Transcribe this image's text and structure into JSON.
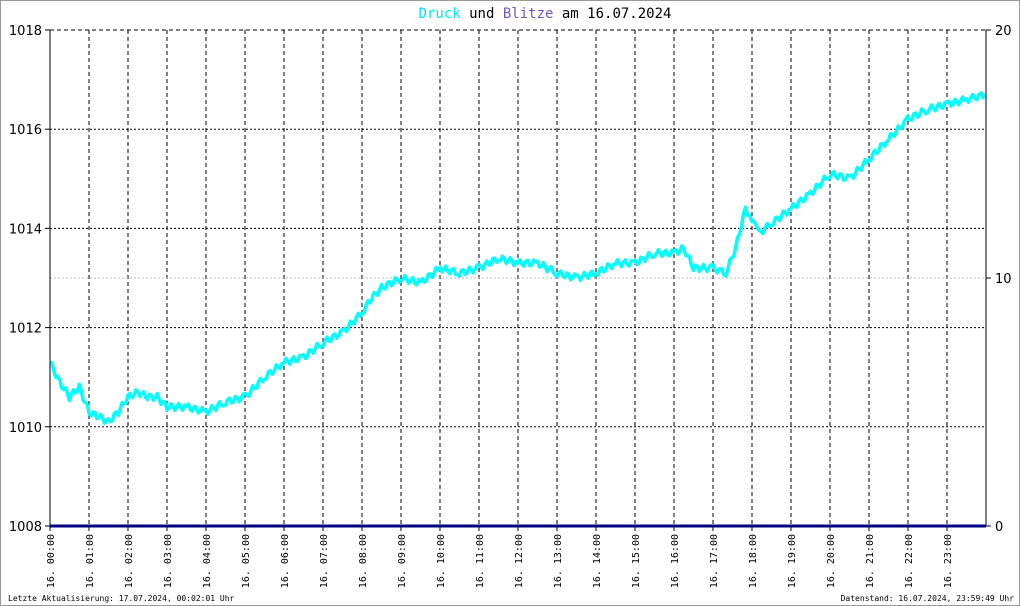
{
  "chart_data": {
    "type": "line",
    "title": {
      "part1": "Druck",
      "part2": " und ",
      "part3": "Blitze",
      "part4": " am 16.07.2024"
    },
    "colors": {
      "druck": "#00ffff",
      "blitze": "#6a5acd",
      "grid": "#000000",
      "axis": "#000080"
    },
    "y_left": {
      "range": [
        1008,
        1018
      ],
      "ticks": [
        "1008",
        "1010",
        "1012",
        "1014",
        "1016",
        "1018"
      ]
    },
    "y_right": {
      "range": [
        0,
        20
      ],
      "ticks": [
        "0",
        "10",
        "20"
      ]
    },
    "x": {
      "range_hours": [
        0,
        24
      ],
      "ticks": [
        "16. 00:00",
        "16. 01:00",
        "16. 02:00",
        "16. 03:00",
        "16. 04:00",
        "16. 05:00",
        "16. 06:00",
        "16. 07:00",
        "16. 08:00",
        "16. 09:00",
        "16. 10:00",
        "16. 11:00",
        "16. 12:00",
        "16. 13:00",
        "16. 14:00",
        "16. 15:00",
        "16. 16:00",
        "16. 17:00",
        "16. 18:00",
        "16. 19:00",
        "16. 20:00",
        "16. 21:00",
        "16. 22:00",
        "16. 23:00"
      ]
    },
    "series": [
      {
        "name": "Druck",
        "points": [
          [
            0,
            1011.3
          ],
          [
            0.25,
            1010.9
          ],
          [
            0.5,
            1010.6
          ],
          [
            0.75,
            1010.8
          ],
          [
            1,
            1010.3
          ],
          [
            1.25,
            1010.2
          ],
          [
            1.5,
            1010.1
          ],
          [
            1.75,
            1010.3
          ],
          [
            2,
            1010.6
          ],
          [
            2.25,
            1010.7
          ],
          [
            2.5,
            1010.6
          ],
          [
            2.75,
            1010.6
          ],
          [
            3,
            1010.4
          ],
          [
            3.5,
            1010.4
          ],
          [
            4,
            1010.3
          ],
          [
            4.5,
            1010.5
          ],
          [
            5,
            1010.6
          ],
          [
            5.5,
            1011.0
          ],
          [
            6,
            1011.3
          ],
          [
            6.5,
            1011.4
          ],
          [
            7,
            1011.7
          ],
          [
            7.5,
            1011.9
          ],
          [
            8,
            1012.3
          ],
          [
            8.25,
            1012.6
          ],
          [
            8.5,
            1012.8
          ],
          [
            9,
            1013.0
          ],
          [
            9.5,
            1012.9
          ],
          [
            10,
            1013.2
          ],
          [
            10.5,
            1013.1
          ],
          [
            11,
            1013.2
          ],
          [
            11.5,
            1013.4
          ],
          [
            12,
            1013.3
          ],
          [
            12.5,
            1013.3
          ],
          [
            13,
            1013.1
          ],
          [
            13.5,
            1013.0
          ],
          [
            14,
            1013.1
          ],
          [
            14.5,
            1013.3
          ],
          [
            15,
            1013.3
          ],
          [
            15.5,
            1013.5
          ],
          [
            16,
            1013.5
          ],
          [
            16.25,
            1013.6
          ],
          [
            16.5,
            1013.2
          ],
          [
            17,
            1013.2
          ],
          [
            17.33,
            1013.1
          ],
          [
            17.58,
            1013.6
          ],
          [
            17.83,
            1014.4
          ],
          [
            18,
            1014.2
          ],
          [
            18.17,
            1013.9
          ],
          [
            18.5,
            1014.1
          ],
          [
            19,
            1014.4
          ],
          [
            19.5,
            1014.7
          ],
          [
            20,
            1015.1
          ],
          [
            20.5,
            1015.0
          ],
          [
            21,
            1015.4
          ],
          [
            21.5,
            1015.8
          ],
          [
            22,
            1016.2
          ],
          [
            22.5,
            1016.4
          ],
          [
            23,
            1016.5
          ],
          [
            23.5,
            1016.6
          ],
          [
            23.98,
            1016.7
          ]
        ]
      },
      {
        "name": "Blitze",
        "points": []
      }
    ]
  },
  "footer": {
    "left": "Letzte Aktualisierung: 17.07.2024, 00:02:01 Uhr",
    "right": "Datenstand: 16.07.2024, 23:59:49 Uhr"
  }
}
